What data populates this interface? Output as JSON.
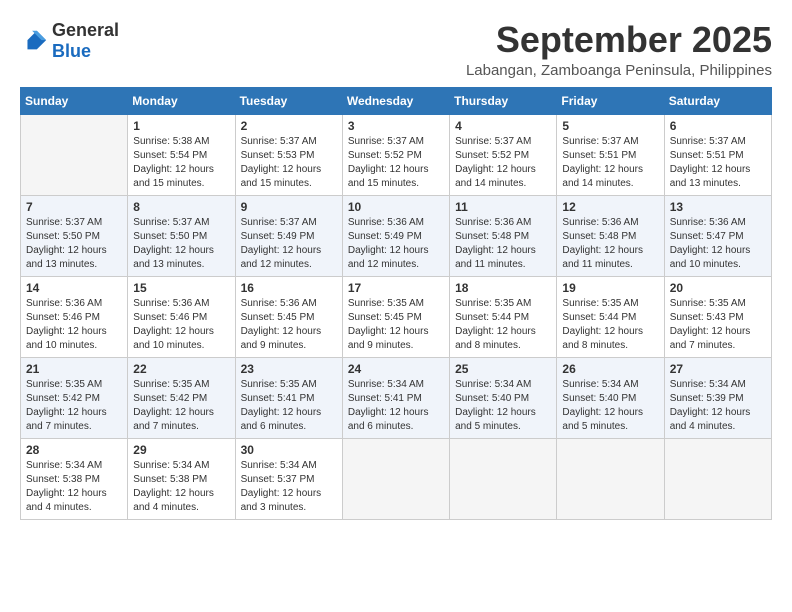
{
  "header": {
    "logo_general": "General",
    "logo_blue": "Blue",
    "month_title": "September 2025",
    "location": "Labangan, Zamboanga Peninsula, Philippines"
  },
  "calendar": {
    "columns": [
      "Sunday",
      "Monday",
      "Tuesday",
      "Wednesday",
      "Thursday",
      "Friday",
      "Saturday"
    ],
    "rows": [
      {
        "cells": [
          {
            "day": "",
            "info": ""
          },
          {
            "day": "1",
            "info": "Sunrise: 5:38 AM\nSunset: 5:54 PM\nDaylight: 12 hours\nand 15 minutes."
          },
          {
            "day": "2",
            "info": "Sunrise: 5:37 AM\nSunset: 5:53 PM\nDaylight: 12 hours\nand 15 minutes."
          },
          {
            "day": "3",
            "info": "Sunrise: 5:37 AM\nSunset: 5:52 PM\nDaylight: 12 hours\nand 15 minutes."
          },
          {
            "day": "4",
            "info": "Sunrise: 5:37 AM\nSunset: 5:52 PM\nDaylight: 12 hours\nand 14 minutes."
          },
          {
            "day": "5",
            "info": "Sunrise: 5:37 AM\nSunset: 5:51 PM\nDaylight: 12 hours\nand 14 minutes."
          },
          {
            "day": "6",
            "info": "Sunrise: 5:37 AM\nSunset: 5:51 PM\nDaylight: 12 hours\nand 13 minutes."
          }
        ]
      },
      {
        "cells": [
          {
            "day": "7",
            "info": "Sunrise: 5:37 AM\nSunset: 5:50 PM\nDaylight: 12 hours\nand 13 minutes."
          },
          {
            "day": "8",
            "info": "Sunrise: 5:37 AM\nSunset: 5:50 PM\nDaylight: 12 hours\nand 13 minutes."
          },
          {
            "day": "9",
            "info": "Sunrise: 5:37 AM\nSunset: 5:49 PM\nDaylight: 12 hours\nand 12 minutes."
          },
          {
            "day": "10",
            "info": "Sunrise: 5:36 AM\nSunset: 5:49 PM\nDaylight: 12 hours\nand 12 minutes."
          },
          {
            "day": "11",
            "info": "Sunrise: 5:36 AM\nSunset: 5:48 PM\nDaylight: 12 hours\nand 11 minutes."
          },
          {
            "day": "12",
            "info": "Sunrise: 5:36 AM\nSunset: 5:48 PM\nDaylight: 12 hours\nand 11 minutes."
          },
          {
            "day": "13",
            "info": "Sunrise: 5:36 AM\nSunset: 5:47 PM\nDaylight: 12 hours\nand 10 minutes."
          }
        ]
      },
      {
        "cells": [
          {
            "day": "14",
            "info": "Sunrise: 5:36 AM\nSunset: 5:46 PM\nDaylight: 12 hours\nand 10 minutes."
          },
          {
            "day": "15",
            "info": "Sunrise: 5:36 AM\nSunset: 5:46 PM\nDaylight: 12 hours\nand 10 minutes."
          },
          {
            "day": "16",
            "info": "Sunrise: 5:36 AM\nSunset: 5:45 PM\nDaylight: 12 hours\nand 9 minutes."
          },
          {
            "day": "17",
            "info": "Sunrise: 5:35 AM\nSunset: 5:45 PM\nDaylight: 12 hours\nand 9 minutes."
          },
          {
            "day": "18",
            "info": "Sunrise: 5:35 AM\nSunset: 5:44 PM\nDaylight: 12 hours\nand 8 minutes."
          },
          {
            "day": "19",
            "info": "Sunrise: 5:35 AM\nSunset: 5:44 PM\nDaylight: 12 hours\nand 8 minutes."
          },
          {
            "day": "20",
            "info": "Sunrise: 5:35 AM\nSunset: 5:43 PM\nDaylight: 12 hours\nand 7 minutes."
          }
        ]
      },
      {
        "cells": [
          {
            "day": "21",
            "info": "Sunrise: 5:35 AM\nSunset: 5:42 PM\nDaylight: 12 hours\nand 7 minutes."
          },
          {
            "day": "22",
            "info": "Sunrise: 5:35 AM\nSunset: 5:42 PM\nDaylight: 12 hours\nand 7 minutes."
          },
          {
            "day": "23",
            "info": "Sunrise: 5:35 AM\nSunset: 5:41 PM\nDaylight: 12 hours\nand 6 minutes."
          },
          {
            "day": "24",
            "info": "Sunrise: 5:34 AM\nSunset: 5:41 PM\nDaylight: 12 hours\nand 6 minutes."
          },
          {
            "day": "25",
            "info": "Sunrise: 5:34 AM\nSunset: 5:40 PM\nDaylight: 12 hours\nand 5 minutes."
          },
          {
            "day": "26",
            "info": "Sunrise: 5:34 AM\nSunset: 5:40 PM\nDaylight: 12 hours\nand 5 minutes."
          },
          {
            "day": "27",
            "info": "Sunrise: 5:34 AM\nSunset: 5:39 PM\nDaylight: 12 hours\nand 4 minutes."
          }
        ]
      },
      {
        "cells": [
          {
            "day": "28",
            "info": "Sunrise: 5:34 AM\nSunset: 5:38 PM\nDaylight: 12 hours\nand 4 minutes."
          },
          {
            "day": "29",
            "info": "Sunrise: 5:34 AM\nSunset: 5:38 PM\nDaylight: 12 hours\nand 4 minutes."
          },
          {
            "day": "30",
            "info": "Sunrise: 5:34 AM\nSunset: 5:37 PM\nDaylight: 12 hours\nand 3 minutes."
          },
          {
            "day": "",
            "info": ""
          },
          {
            "day": "",
            "info": ""
          },
          {
            "day": "",
            "info": ""
          },
          {
            "day": "",
            "info": ""
          }
        ]
      }
    ]
  }
}
